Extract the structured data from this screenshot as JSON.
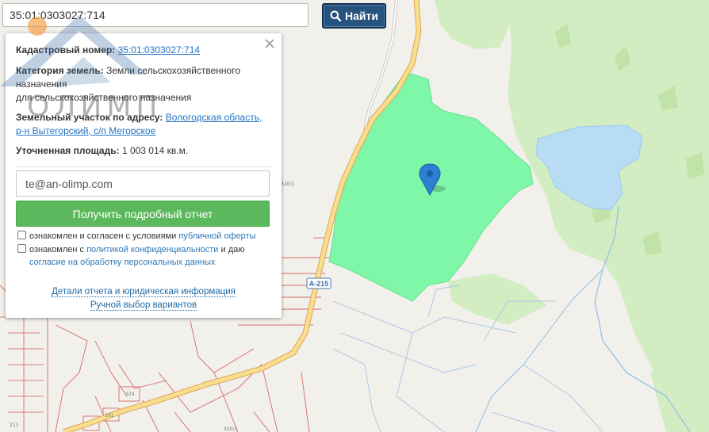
{
  "search": {
    "value": "35:01:0303027:714",
    "button_label": "Найти"
  },
  "logo": {
    "text": "ОЛИМП"
  },
  "popup": {
    "cadastral_label": "Кадастровый номер:",
    "cadastral_value": "35:01:0303027:714",
    "category_label": "Категория земель:",
    "category_value_1": "Земли сельскохозяйственного",
    "category_value_2": "назначения",
    "category_value_3": "для сельскохозяйственного назначения",
    "address_label": "Земельный участок по адресу:",
    "address_value_1": "Вологодская область,",
    "address_value_2": "р-н Вытегорский, с/п Мегорское",
    "area_label": "Уточненная площадь:",
    "area_value": "1 003 014 кв.м.",
    "email_value": "te@an-olimp.com",
    "report_button": "Получить подробный отчет",
    "consent1_text": "ознакомлен и согласен с условиями",
    "consent1_link": "публичной оферты",
    "consent2_text_a": "ознакомлен с",
    "consent2_link_a": "политикой конфиденциальности",
    "consent2_text_b": "и даю",
    "consent2_link_b": "согласие на обработку персональных данных",
    "details_link": "Детали отчета и юридическая информация",
    "manual_link": "Ручной выбор вариантов"
  },
  "map": {
    "road_label": "A-215",
    "labels": {
      "n320_1": "320/1",
      "n324": "324",
      "n211": "211",
      "n161": "161",
      "n320_1b": "320/1"
    }
  },
  "colors": {
    "parcel": "#7df5a6",
    "forest": "#d2ecc1",
    "water": "#b8dbf4",
    "road": "#f7d887",
    "search_button": "#27537f",
    "report_button": "#5cb85c"
  }
}
